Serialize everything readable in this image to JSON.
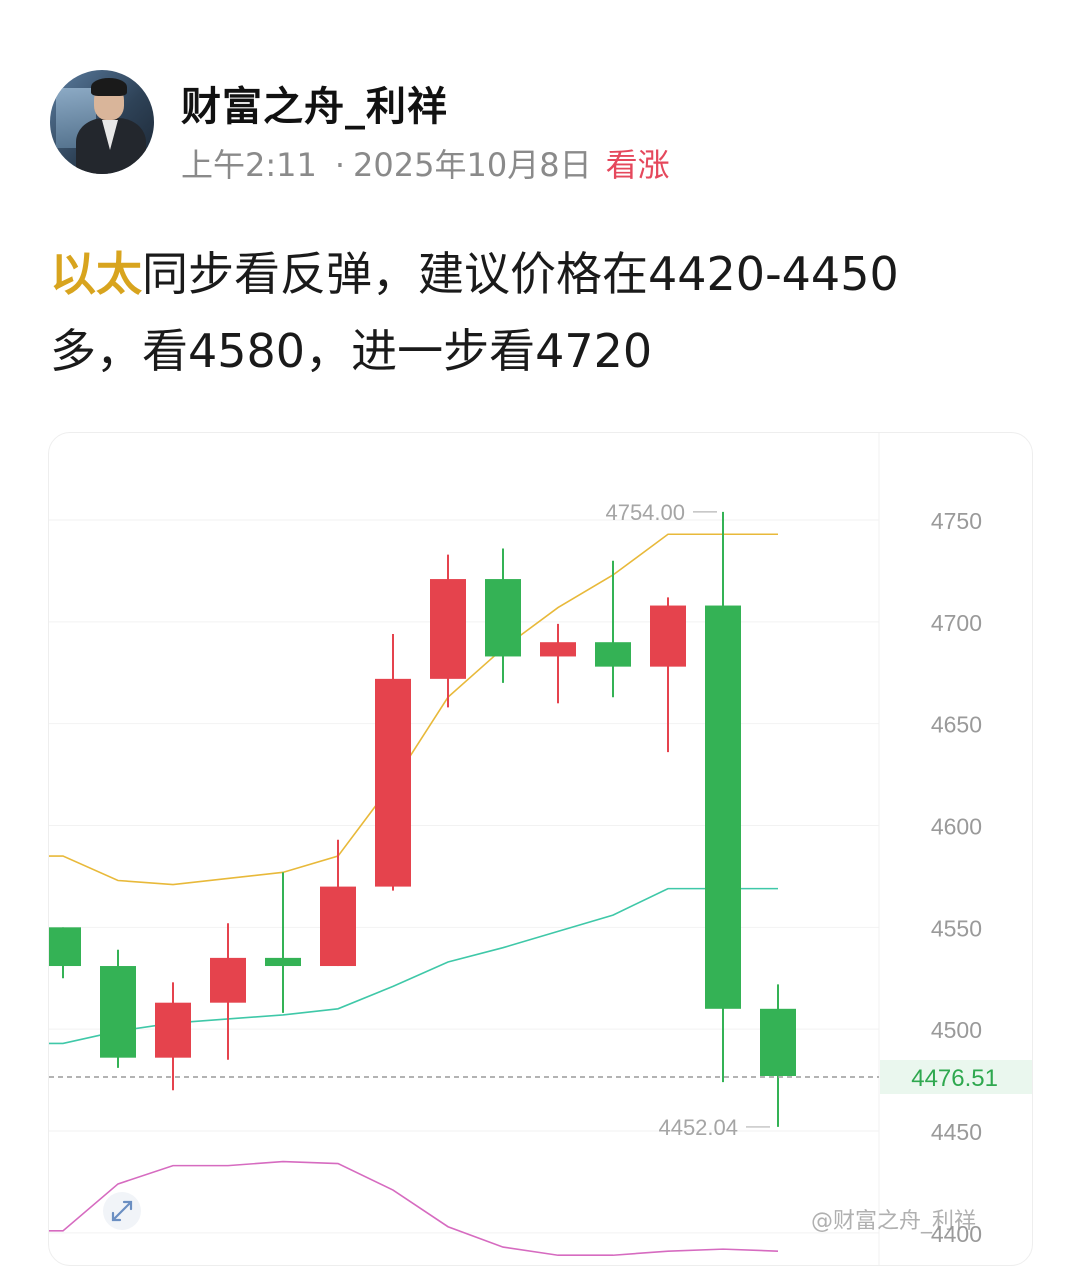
{
  "post": {
    "username": "财富之舟_利祥",
    "time": "上午2:11",
    "date": "2025年10月8日",
    "sentiment_tag": "看涨",
    "text_highlight": "以太",
    "text_line1_rest": "同步看反弹，建议价格在4420-4450",
    "text_line2": "多，看4580，进一步看4720"
  },
  "watermark": "@财富之舟_利祥",
  "colors": {
    "up": "#e5434d",
    "down": "#34b255",
    "upper_band": "#e8b93a",
    "mid_band": "#3fc8a8",
    "indicator": "#d66bc0",
    "tag": "#e5485c",
    "highlight": "#d8a41e"
  },
  "icons": {
    "expand": "expand-arrows-icon"
  },
  "chart_data": {
    "type": "candlestick",
    "ylim": [
      4400,
      4775
    ],
    "yticks": [
      4750,
      4700,
      4650,
      4600,
      4550,
      4500,
      4450,
      4400
    ],
    "current_price": 4476.51,
    "high_label": "4754.00",
    "low_label": "4452.04",
    "candles": [
      {
        "open": 4550,
        "close": 4531,
        "high": 4550,
        "low": 4525
      },
      {
        "open": 4531,
        "close": 4486,
        "high": 4539,
        "low": 4481
      },
      {
        "open": 4486,
        "close": 4513,
        "high": 4523,
        "low": 4470
      },
      {
        "open": 4513,
        "close": 4535,
        "high": 4552,
        "low": 4485
      },
      {
        "open": 4535,
        "close": 4531,
        "high": 4577,
        "low": 4508
      },
      {
        "open": 4531,
        "close": 4570,
        "high": 4593,
        "low": 4531
      },
      {
        "open": 4570,
        "close": 4672,
        "high": 4694,
        "low": 4568
      },
      {
        "open": 4672,
        "close": 4721,
        "high": 4733,
        "low": 4658
      },
      {
        "open": 4721,
        "close": 4683,
        "high": 4736,
        "low": 4670
      },
      {
        "open": 4683,
        "close": 4690,
        "high": 4699,
        "low": 4660
      },
      {
        "open": 4690,
        "close": 4678,
        "high": 4730,
        "low": 4663
      },
      {
        "open": 4678,
        "close": 4708,
        "high": 4712,
        "low": 4636
      },
      {
        "open": 4708,
        "close": 4510,
        "high": 4754,
        "low": 4474
      },
      {
        "open": 4510,
        "close": 4477,
        "high": 4522,
        "low": 4452
      }
    ],
    "upper_band": [
      4585,
      4573,
      4571,
      4574,
      4577,
      4585,
      4621,
      4663,
      4687,
      4707,
      4723,
      4743,
      4743,
      4743
    ],
    "mid_band": [
      4493,
      4499,
      4503,
      4505,
      4507,
      4510,
      4521,
      4533,
      4540,
      4548,
      4556,
      4569,
      4569,
      4569
    ],
    "lower_band": [
      4401,
      4424,
      4433,
      4433,
      4435,
      4434,
      4421,
      4403,
      4393,
      4389,
      4389,
      4391,
      4392,
      4391
    ]
  }
}
